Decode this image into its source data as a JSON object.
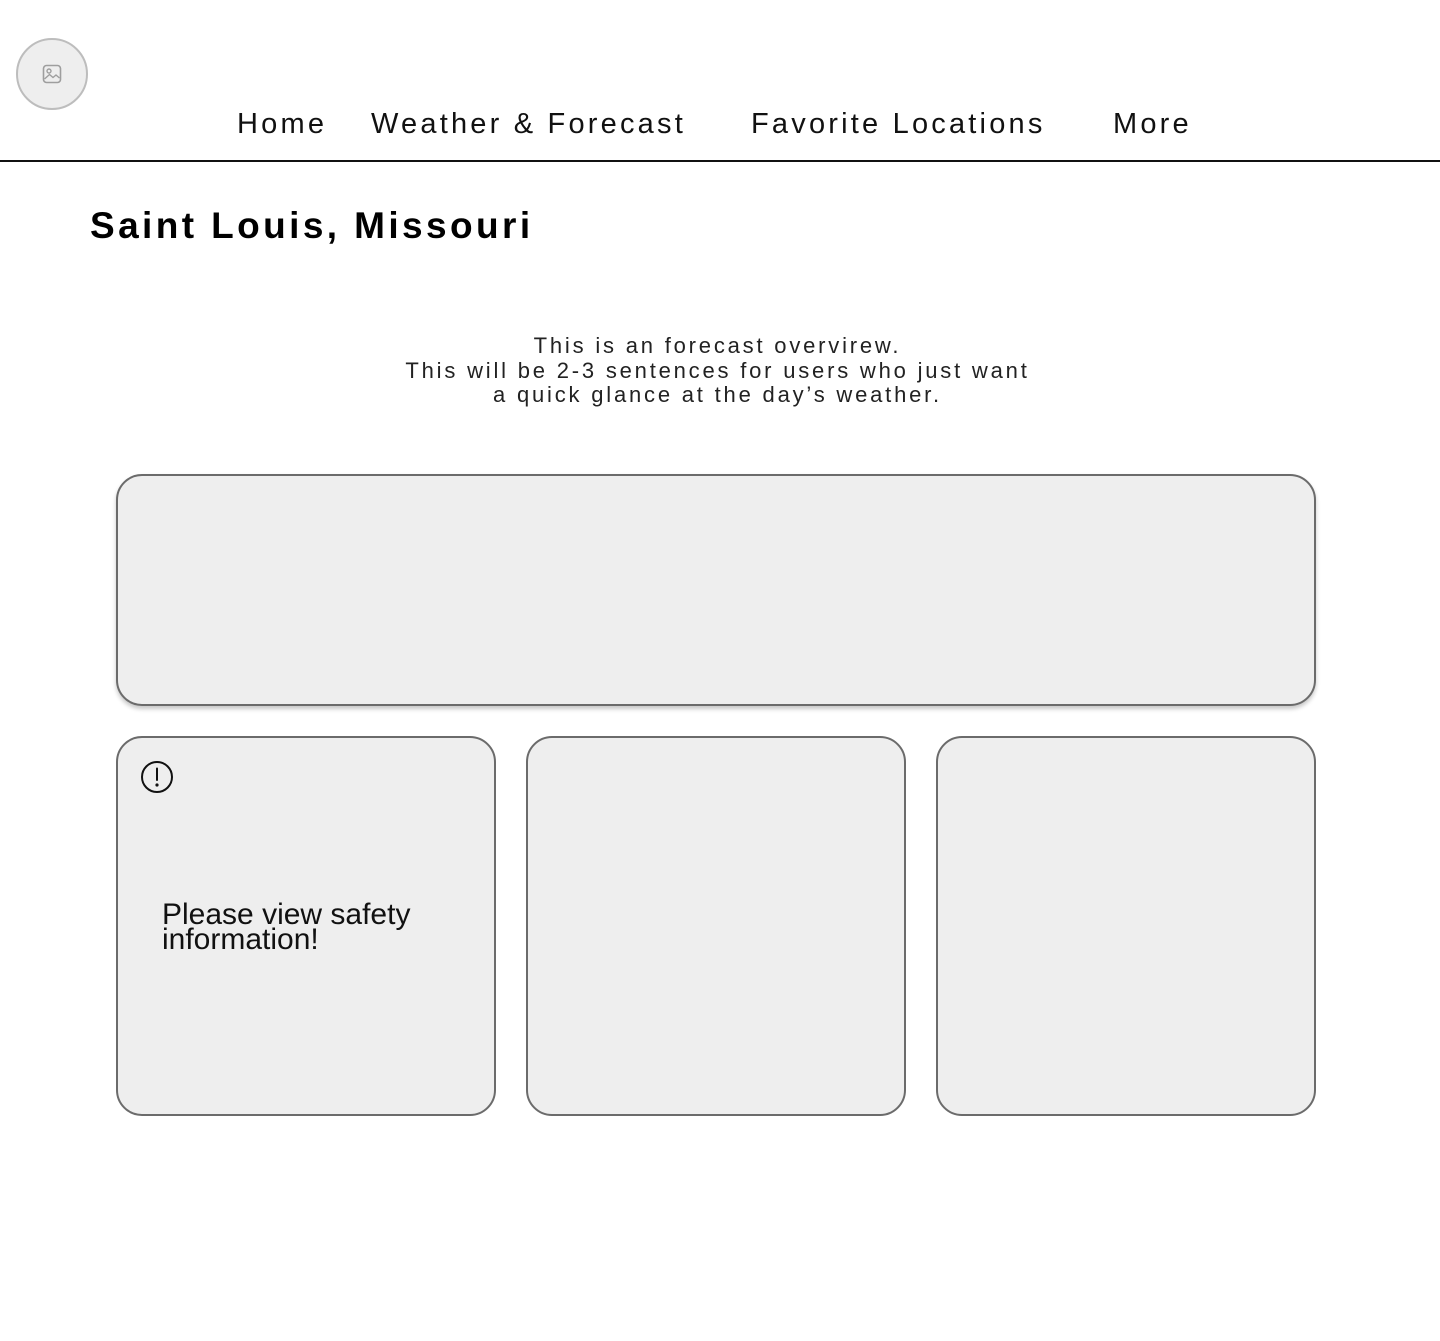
{
  "header": {
    "logo_icon": "image-placeholder-icon",
    "nav": {
      "home": "Home",
      "weather_forecast": "Weather & Forecast",
      "favorite_locations": "Favorite Locations",
      "more": "More"
    }
  },
  "main": {
    "title": "Saint Louis, Missouri",
    "overview": {
      "line1": "This is an forecast overvirew.",
      "line2": "This will be 2-3 sentences for users who just want",
      "line3": "a quick glance at the day’s weather."
    },
    "cards": {
      "safety": {
        "icon": "alert-circle-icon",
        "text": "Please view safety information!"
      }
    }
  },
  "colors": {
    "card_background": "#eeeeee",
    "card_border": "#6b6b6b",
    "text": "#111111"
  }
}
